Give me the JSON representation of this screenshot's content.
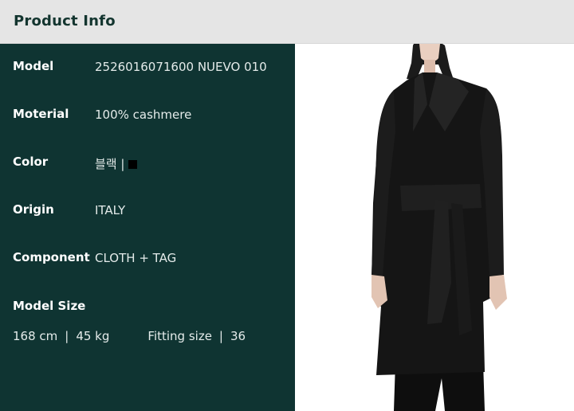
{
  "header": {
    "title": "Product Info"
  },
  "specs": [
    {
      "label": "Model",
      "value": "2526016071600 NUEVO 010"
    },
    {
      "label": "Moterial",
      "value": "100% cashmere"
    },
    {
      "label": "Color",
      "value": "블랙 |"
    },
    {
      "label": "Origin",
      "value": "ITALY"
    },
    {
      "label": "Component",
      "value": "CLOTH + TAG"
    }
  ],
  "model_size": {
    "title": "Model Size",
    "height": "168 cm",
    "weight": "45 kg",
    "fitting_label": "Fitting size",
    "fitting_value": "36",
    "separator": "|"
  },
  "colors": {
    "header_bg": "#e5e5e5",
    "header_text": "#13352f",
    "panel_bg": "#0f3432",
    "swatch": "#000000",
    "coat": "#141414"
  }
}
